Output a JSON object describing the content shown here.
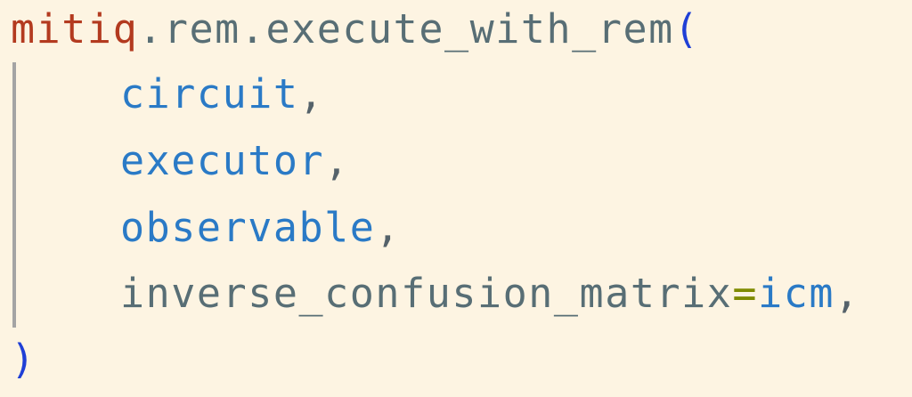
{
  "code": {
    "module": "mitiq",
    "dot_1": ".",
    "submodule": "rem",
    "dot_2": ".",
    "function": "execute_with_rem",
    "open_paren": "(",
    "arguments": [
      {
        "name": "circuit",
        "comma": ","
      },
      {
        "name": "executor",
        "comma": ","
      },
      {
        "name": "observable",
        "comma": ","
      }
    ],
    "keyword_argument": {
      "name": "inverse_confusion_matrix",
      "equals": "=",
      "value": "icm",
      "comma": ","
    },
    "close_paren": ")"
  },
  "colors": {
    "background": "#fdf4e2",
    "module": "#b33a1f",
    "attribute": "#586e75",
    "parenthesis": "#1f3fd6",
    "argument": "#2a7ac6",
    "equals": "#7f8b00",
    "indent_guide": "#a4a4a4"
  }
}
